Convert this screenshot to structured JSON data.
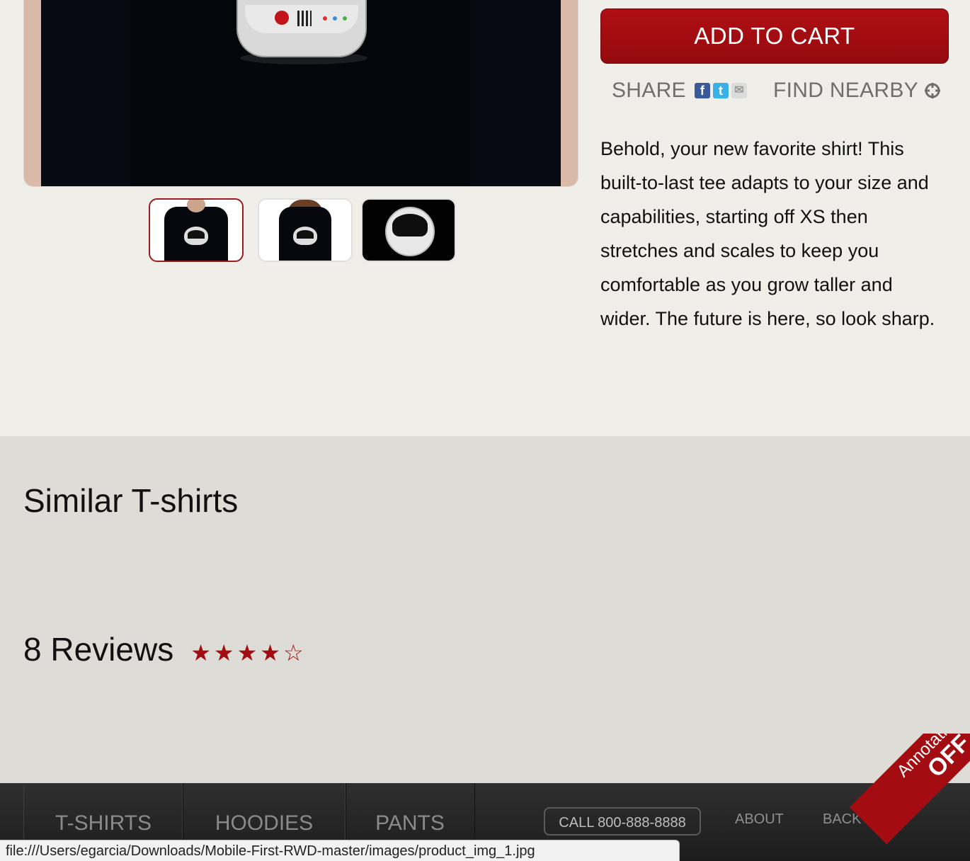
{
  "product": {
    "add_to_cart": "ADD TO CART",
    "share_label": "SHARE",
    "find_nearby_label": "FIND NEARBY",
    "description": "Behold, your new favorite shirt! This built-to-last tee adapts to your size and capabilities, starting off XS then stretches and scales to keep you comfortable as you grow taller and wider. The future is here, so look sharp.",
    "social_icons": [
      "facebook-icon",
      "twitter-icon",
      "email-icon"
    ],
    "thumbnails": [
      "thumbnail-man-shirt",
      "thumbnail-woman-shirt",
      "thumbnail-helmet-closeup"
    ],
    "active_thumbnail_index": 0
  },
  "similar": {
    "title": "Similar T-shirts"
  },
  "reviews": {
    "title": "8 Reviews",
    "rating": 4,
    "max_rating": 5,
    "star_filled": "★",
    "star_empty": "☆"
  },
  "footer": {
    "nav": [
      "T-SHIRTS",
      "HOODIES",
      "PANTS"
    ],
    "call": "CALL 800-888-8888",
    "about": "ABOUT",
    "back_to_top": "BACK TO"
  },
  "statusbar": {
    "url": "file:///Users/egarcia/Downloads/Mobile-First-RWD-master/images/product_img_1.jpg"
  },
  "ribbon": {
    "line1": "Annotations:",
    "line2": "OFF"
  },
  "colors": {
    "accent": "#a30d12",
    "background": "#efeee8",
    "footer": "#262626"
  }
}
